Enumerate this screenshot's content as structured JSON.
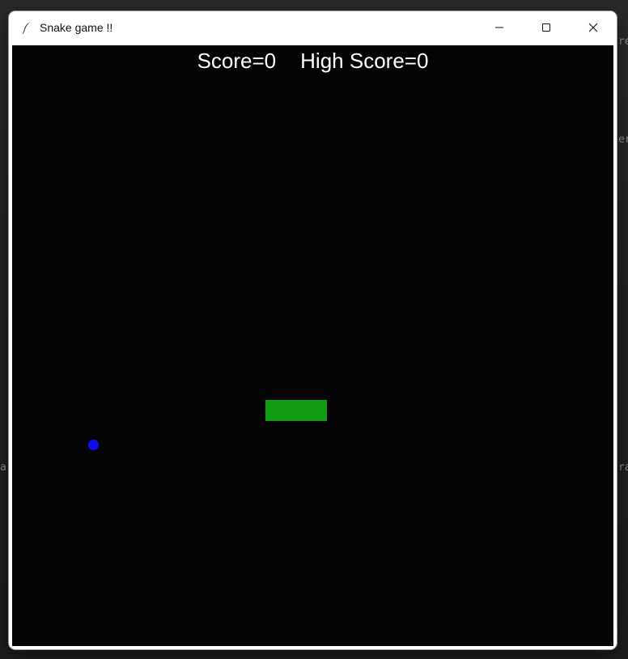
{
  "window": {
    "title": "Snake game !!",
    "minimize_icon": "minimize-icon",
    "maximize_icon": "maximize-icon",
    "close_icon": "close-icon",
    "app_icon": "feather-icon"
  },
  "hud": {
    "score_label": "Score=0",
    "high_score_label": "High Score=0",
    "score": 0,
    "high_score": 0
  },
  "game": {
    "snake_color": "#119b11",
    "food_color": "#0d0df0",
    "background_color": "#040406",
    "snake_length_segments": 3
  },
  "backdrop": {
    "right_edge_texts": [
      "re",
      "er",
      "ra"
    ],
    "left_edge_texts": [
      "a"
    ]
  }
}
